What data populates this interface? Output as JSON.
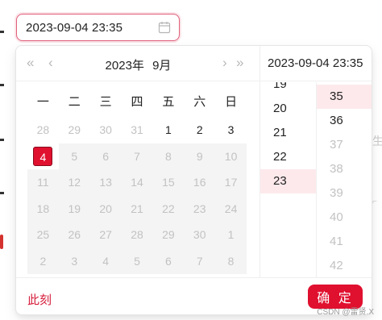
{
  "input": {
    "value": "2023-09-04 23:35",
    "icon": "calendar-icon"
  },
  "header": {
    "prev_year": "«",
    "prev_month": "‹",
    "year": "2023年",
    "month": "9月",
    "next_month": "›",
    "next_year": "»"
  },
  "weekdays": [
    "一",
    "二",
    "三",
    "四",
    "五",
    "六",
    "日"
  ],
  "weeks": [
    [
      {
        "d": "28",
        "s": "other"
      },
      {
        "d": "29",
        "s": "other"
      },
      {
        "d": "30",
        "s": "other"
      },
      {
        "d": "31",
        "s": "other"
      },
      {
        "d": "1",
        "s": "in-month"
      },
      {
        "d": "2",
        "s": "in-month"
      },
      {
        "d": "3",
        "s": "in-month"
      }
    ],
    [
      {
        "d": "4",
        "s": "selected"
      },
      {
        "d": "5",
        "s": "disabled"
      },
      {
        "d": "6",
        "s": "disabled"
      },
      {
        "d": "7",
        "s": "disabled"
      },
      {
        "d": "8",
        "s": "disabled"
      },
      {
        "d": "9",
        "s": "disabled"
      },
      {
        "d": "10",
        "s": "disabled"
      }
    ],
    [
      {
        "d": "11",
        "s": "disabled"
      },
      {
        "d": "12",
        "s": "disabled"
      },
      {
        "d": "13",
        "s": "disabled"
      },
      {
        "d": "14",
        "s": "disabled"
      },
      {
        "d": "15",
        "s": "disabled"
      },
      {
        "d": "16",
        "s": "disabled"
      },
      {
        "d": "17",
        "s": "disabled"
      }
    ],
    [
      {
        "d": "18",
        "s": "disabled"
      },
      {
        "d": "19",
        "s": "disabled"
      },
      {
        "d": "20",
        "s": "disabled"
      },
      {
        "d": "21",
        "s": "disabled"
      },
      {
        "d": "22",
        "s": "disabled"
      },
      {
        "d": "23",
        "s": "disabled"
      },
      {
        "d": "24",
        "s": "disabled"
      }
    ],
    [
      {
        "d": "25",
        "s": "disabled"
      },
      {
        "d": "26",
        "s": "disabled"
      },
      {
        "d": "27",
        "s": "disabled"
      },
      {
        "d": "28",
        "s": "disabled"
      },
      {
        "d": "29",
        "s": "disabled"
      },
      {
        "d": "30",
        "s": "disabled"
      },
      {
        "d": "1",
        "s": "disabled"
      }
    ],
    [
      {
        "d": "2",
        "s": "disabled"
      },
      {
        "d": "3",
        "s": "disabled"
      },
      {
        "d": "4",
        "s": "disabled"
      },
      {
        "d": "5",
        "s": "disabled"
      },
      {
        "d": "6",
        "s": "disabled"
      },
      {
        "d": "7",
        "s": "disabled"
      },
      {
        "d": "8",
        "s": "disabled"
      }
    ]
  ],
  "time": {
    "display": "2023-09-04 23:35",
    "hours": [
      {
        "v": "19",
        "s": "normal"
      },
      {
        "v": "20",
        "s": "normal"
      },
      {
        "v": "21",
        "s": "normal"
      },
      {
        "v": "22",
        "s": "normal"
      },
      {
        "v": "23",
        "s": "active"
      }
    ],
    "minutes": [
      {
        "v": "35",
        "s": "active"
      },
      {
        "v": "36",
        "s": "normal"
      },
      {
        "v": "37",
        "s": "dim"
      },
      {
        "v": "38",
        "s": "dim"
      },
      {
        "v": "39",
        "s": "dim"
      },
      {
        "v": "40",
        "s": "dim"
      },
      {
        "v": "41",
        "s": "dim"
      },
      {
        "v": "42",
        "s": "dim"
      }
    ]
  },
  "footer": {
    "now_label": "此刻",
    "ok_label": "确 定"
  },
  "background": {
    "ghost_char": "生",
    "watermark": "CSDN @雷贤.X"
  },
  "colors": {
    "accent": "#e0102f",
    "selected_bg": "#fde9ec",
    "disabled_bg": "#f4f4f4"
  }
}
